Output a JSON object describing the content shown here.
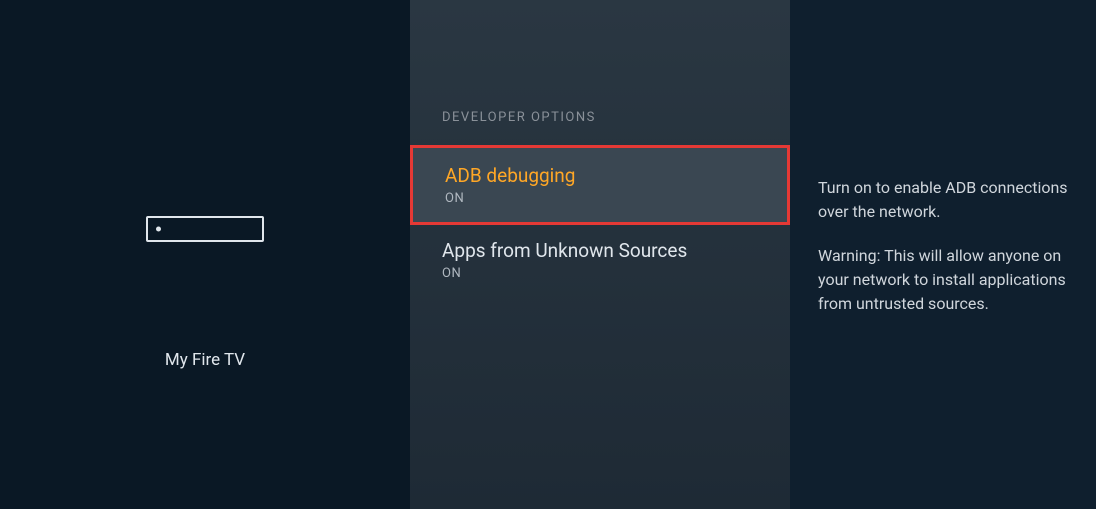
{
  "leftPanel": {
    "deviceLabel": "My Fire TV"
  },
  "middlePanel": {
    "sectionHeader": "DEVELOPER OPTIONS",
    "options": [
      {
        "title": "ADB debugging",
        "status": "ON"
      },
      {
        "title": "Apps from Unknown Sources",
        "status": "ON"
      }
    ]
  },
  "rightPanel": {
    "description1": "Turn on to enable ADB connections over the network.",
    "description2": "Warning: This will allow anyone on your network to install applications from untrusted sources."
  }
}
